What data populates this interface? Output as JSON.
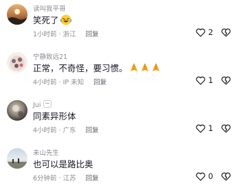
{
  "comments": [
    {
      "username": "读叫我平哥",
      "text": "笑死了",
      "emoji_icon": "laughing-face-emoji",
      "time_location": "1小时前 · 浙江",
      "reply_label": "回复",
      "likes": "2"
    },
    {
      "username": "宁静致远21",
      "text": "正常，不奇怪，要习惯。",
      "emoji_icon": "praying-hands-emoji",
      "time_location": "4小时前 · IP 未知",
      "reply_label": "回复",
      "likes": "1"
    },
    {
      "username": "Jui",
      "text": "同素异形体",
      "time_location": "4小时前 · 广东",
      "reply_label": "回复",
      "likes": "1"
    },
    {
      "username": "未山先生",
      "text": "也可以是路比奥",
      "time_location": "6分钟前 · 江苏",
      "reply_label": "回复",
      "likes": "0"
    }
  ],
  "colors": {
    "text": "#161823",
    "secondary": "#8a8b91",
    "background": "#ffffff"
  }
}
